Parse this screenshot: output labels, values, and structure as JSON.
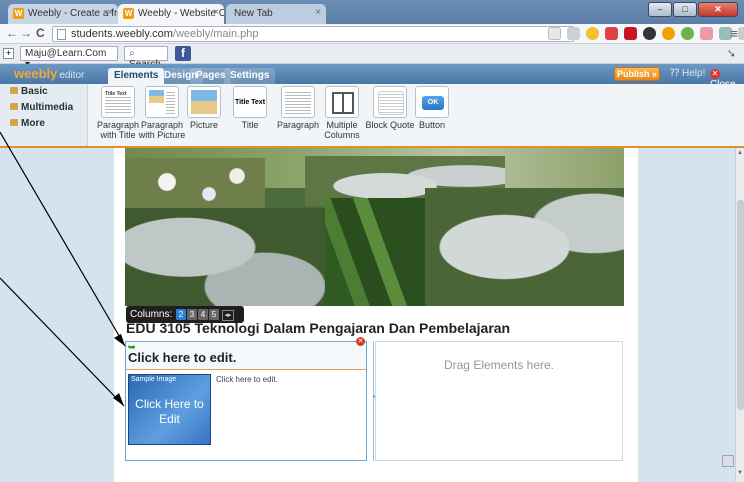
{
  "browser": {
    "tabs": [
      {
        "label": "Weebly - Create a free wi",
        "favicon": "W",
        "state": "inactive"
      },
      {
        "label": "Weebly - Website Creatio",
        "favicon": "W",
        "state": "active"
      },
      {
        "label": "New Tab",
        "favicon": "",
        "state": "inactive"
      }
    ],
    "tab_close_glyph": "×",
    "window_controls": {
      "minimize": "–",
      "maximize": "□",
      "close": "✕"
    },
    "nav": {
      "back": "←",
      "forward": "→",
      "reload": "C"
    },
    "url": {
      "host": "students.weebly.com",
      "path": "/weebly/main.php"
    },
    "wrench_glyph": "≡"
  },
  "toolbar": {
    "plus_glyph": "+",
    "profile_select": "Maju@Learn.Com",
    "search_label": "Search",
    "facebook_glyph": "f"
  },
  "weebly": {
    "logo": "weebly",
    "logo_suffix": "editor",
    "tabs": [
      "Elements",
      "Design",
      "Pages",
      "Settings"
    ],
    "active_tab": "Elements",
    "publish_label": "Publish »",
    "help_label": "Help!",
    "close_label": "Close"
  },
  "side_menu": [
    "Basic",
    "Multimedia",
    "More"
  ],
  "elements": [
    {
      "label": "Paragraph with Title",
      "icon": "paragraph-title-icon",
      "thumb_text": "Title Text"
    },
    {
      "label": "Paragraph with Picture",
      "icon": "paragraph-picture-icon",
      "thumb_text": ""
    },
    {
      "label": "Picture",
      "icon": "picture-icon",
      "thumb_text": ""
    },
    {
      "label": "Title",
      "icon": "title-icon",
      "thumb_text": "Title Text"
    },
    {
      "label": "Paragraph",
      "icon": "paragraph-icon",
      "thumb_text": ""
    },
    {
      "label": "Multiple Columns",
      "icon": "columns-icon",
      "thumb_text": ""
    },
    {
      "label": "Block Quote",
      "icon": "block-quote-icon",
      "thumb_text": ""
    },
    {
      "label": "Button",
      "icon": "button-icon",
      "thumb_text": "OK"
    }
  ],
  "page": {
    "columns_label": "Columns:",
    "column_options": [
      "2",
      "3",
      "4",
      "5"
    ],
    "active_columns": "2",
    "column_adjust_glyph": "◂▸",
    "site_title": "EDU 3105 Teknologi Dalam Pengajaran Dan Pembelajaran",
    "left_column": {
      "heading": "Click here to edit.",
      "sample_label": "Sample Image",
      "sample_cta": "Click Here to Edit",
      "paragraph": "Click here to edit."
    },
    "right_column": {
      "placeholder": "Drag Elements here."
    }
  },
  "colors": {
    "accent_orange": "#e08f2a",
    "weebly_blue": "#4a78a6",
    "selection_blue": "#6aa6d6"
  }
}
